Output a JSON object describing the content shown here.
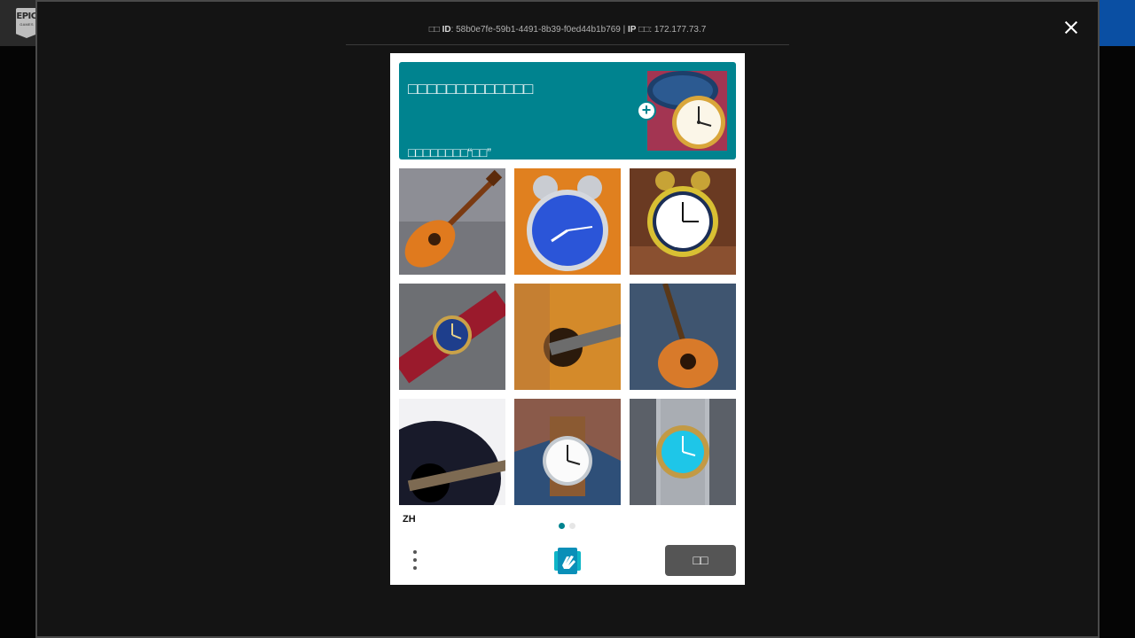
{
  "background": {
    "logo_text": "EPIC",
    "logo_sub": "GAMES"
  },
  "modal": {
    "request_info": {
      "id_prefix": "□□",
      "id_label": "ID",
      "id_value": "58b0e7fe-59b1-4491-8b39-f0ed44b1b769",
      "separator": "|",
      "ip_label": "IP",
      "ip_suffix": "□□:",
      "ip_value": "172.177.73.7"
    }
  },
  "captcha": {
    "prompt_title": "□□□□□□□□□□□□□",
    "prompt_subtitle": "□□□□□□□□“□□”",
    "tiles": [
      {
        "subject": "guitar"
      },
      {
        "subject": "alarm-clock"
      },
      {
        "subject": "alarm-clock"
      },
      {
        "subject": "wristwatch"
      },
      {
        "subject": "guitar"
      },
      {
        "subject": "guitar"
      },
      {
        "subject": "guitar"
      },
      {
        "subject": "wristwatch"
      },
      {
        "subject": "wristwatch"
      }
    ],
    "language": "ZH",
    "page_dots": 2,
    "active_page": 1,
    "next_label": "□□"
  },
  "colors": {
    "accent": "#00838f",
    "modal_bg": "#141414",
    "next_button": "#555555",
    "epic_blue": "#0a4fa3"
  }
}
